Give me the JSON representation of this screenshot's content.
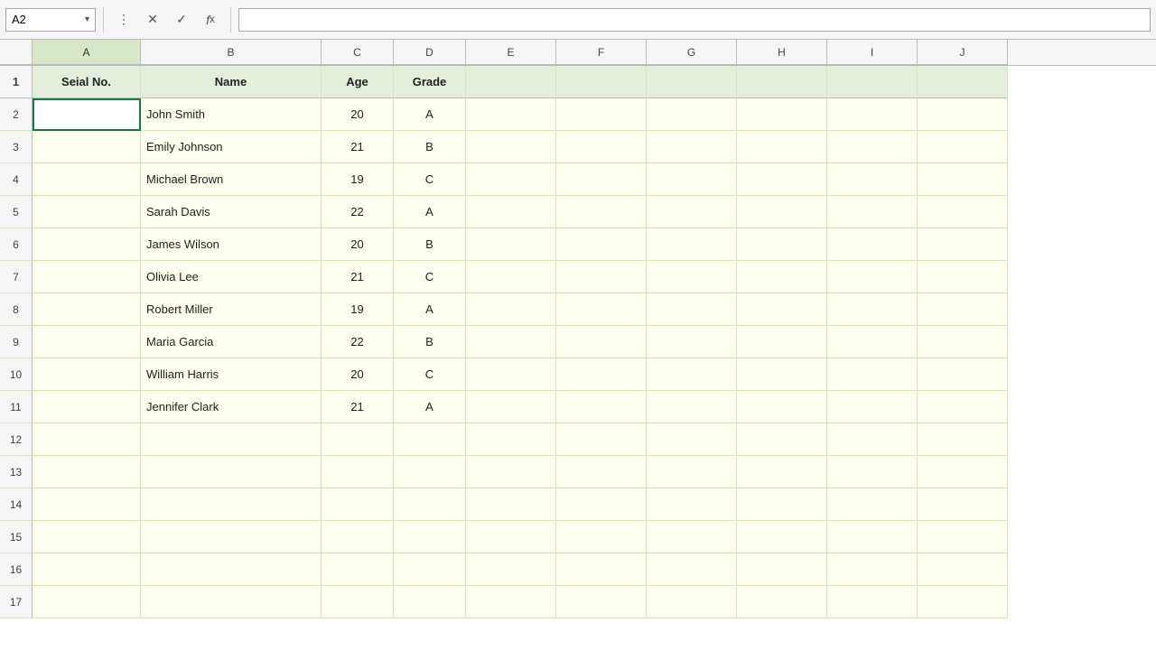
{
  "toolbar": {
    "cell_ref": "A2",
    "formula_bar_value": ""
  },
  "col_headers": [
    "A",
    "B",
    "C",
    "D",
    "E",
    "F",
    "G",
    "H",
    "I",
    "J"
  ],
  "headers": {
    "serial": "Seial No.",
    "name": "Name",
    "age": "Age",
    "grade": "Grade"
  },
  "rows": [
    {
      "row": 2,
      "serial": "",
      "name": "John Smith",
      "age": "20",
      "grade": "A"
    },
    {
      "row": 3,
      "serial": "",
      "name": "Emily Johnson",
      "age": "21",
      "grade": "B"
    },
    {
      "row": 4,
      "serial": "",
      "name": "Michael Brown",
      "age": "19",
      "grade": "C"
    },
    {
      "row": 5,
      "serial": "",
      "name": "Sarah Davis",
      "age": "22",
      "grade": "A"
    },
    {
      "row": 6,
      "serial": "",
      "name": "James Wilson",
      "age": "20",
      "grade": "B"
    },
    {
      "row": 7,
      "serial": "",
      "name": "Olivia Lee",
      "age": "21",
      "grade": "C"
    },
    {
      "row": 8,
      "serial": "",
      "name": "Robert Miller",
      "age": "19",
      "grade": "A"
    },
    {
      "row": 9,
      "serial": "",
      "name": "Maria Garcia",
      "age": "22",
      "grade": "B"
    },
    {
      "row": 10,
      "serial": "",
      "name": "William Harris",
      "age": "20",
      "grade": "C"
    },
    {
      "row": 11,
      "serial": "",
      "name": "Jennifer Clark",
      "age": "21",
      "grade": "A"
    }
  ],
  "empty_rows": [
    12,
    13,
    14,
    15,
    16,
    17
  ]
}
